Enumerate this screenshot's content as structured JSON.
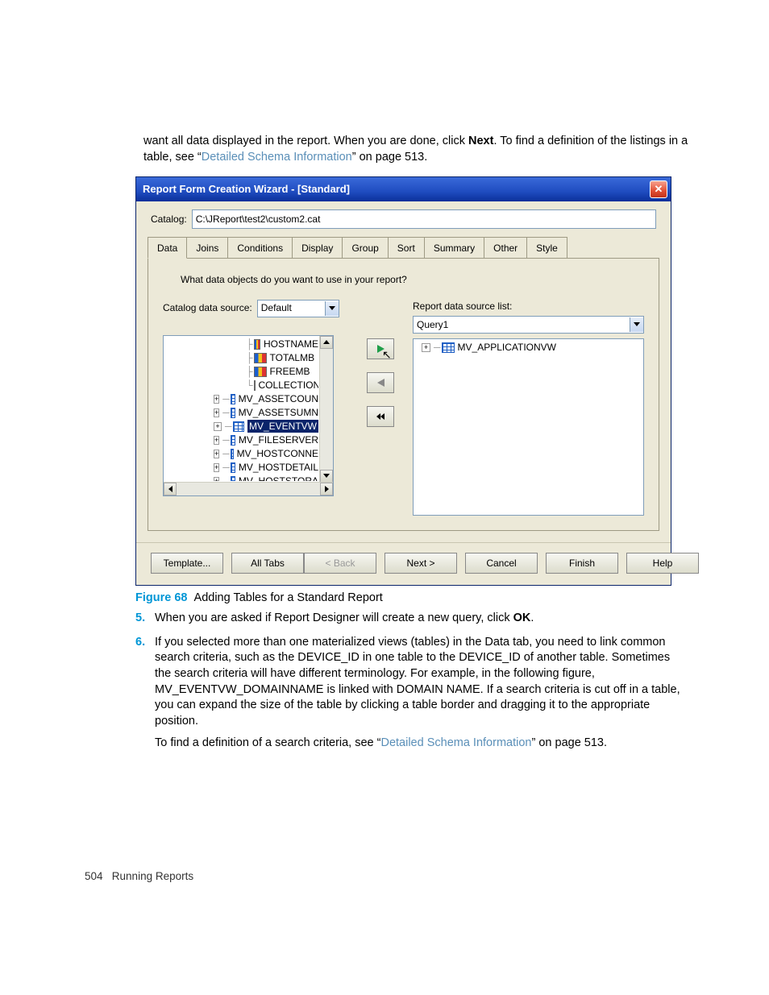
{
  "intro": {
    "line1_a": "want all data displayed in the report. When you are done, click ",
    "line1_bold": "Next",
    "line1_b": ". To find a definition of the listings in a table, see “",
    "line1_link": "Detailed Schema Information",
    "line1_c": "” on page 513."
  },
  "dialog": {
    "title": "Report Form Creation Wizard - [Standard]",
    "catalog_label": "Catalog:",
    "catalog_value": "C:\\JReport\\test2\\custom2.cat",
    "tabs": [
      "Data",
      "Joins",
      "Conditions",
      "Display",
      "Group",
      "Sort",
      "Summary",
      "Other",
      "Style"
    ],
    "active_tab": 0,
    "prompt": "What data objects do you want to use in your report?",
    "catalog_ds_label": "Catalog data source:",
    "catalog_ds_value": "Default",
    "report_ds_label": "Report data source list:",
    "report_ds_value": "Query1",
    "left_tree": {
      "columns": [
        "HOSTNAME",
        "TOTALMB",
        "FREEMB",
        "COLLECTION"
      ],
      "views": [
        "MV_ASSETCOUN",
        "MV_ASSETSUMN",
        "MV_EVENTVW",
        "MV_FILESERVER",
        "MV_HOSTCONNE",
        "MV_HOSTDETAIL",
        "MV_HOSTSTORA"
      ],
      "selected_view_index": 2
    },
    "right_tree": {
      "views": [
        "MV_APPLICATIONVW"
      ]
    },
    "buttons": {
      "template": "Template...",
      "alltabs": "All Tabs",
      "back": "< Back",
      "next": "Next >",
      "cancel": "Cancel",
      "finish": "Finish",
      "help": "Help"
    }
  },
  "figure": {
    "label": "Figure 68",
    "caption": "Adding Tables for a Standard Report"
  },
  "steps": {
    "s5": {
      "num": "5.",
      "a": "When you are asked if Report Designer will create a new query, click ",
      "bold": "OK",
      "b": "."
    },
    "s6": {
      "num": "6.",
      "text": "If you selected more than one materialized views (tables) in the Data tab, you need to link common search criteria, such as the DEVICE_ID in one table to the DEVICE_ID of another table. Sometimes the search criteria will have different terminology. For example, in the following figure, MV_EVENTVW_DOMAINNAME is linked with DOMAIN NAME. If a search criteria is cut off in a table, you can expand the size of the table by clicking a table border and dragging it to the appropriate position.",
      "b_a": "To find a definition of a search criteria, see “",
      "b_link": "Detailed Schema Information",
      "b_b": "” on page 513."
    }
  },
  "footer": {
    "page": "504",
    "section": "Running Reports"
  }
}
